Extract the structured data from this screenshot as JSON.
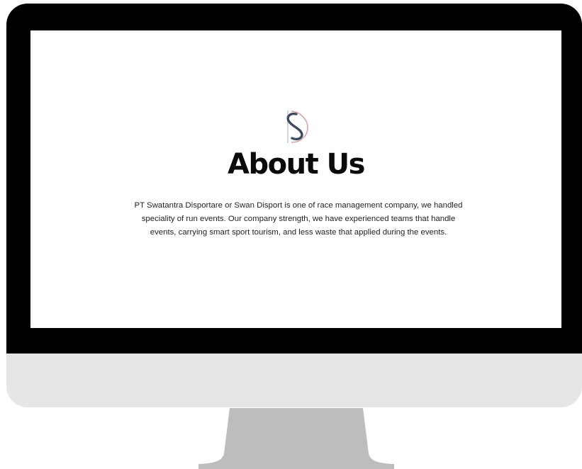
{
  "about": {
    "title": "About Us",
    "description": "PT Swatantra Disportare or Swan Disport is one of race management company, we handled speciality of run events. Our company strength, we have experienced teams that handle events, carrying smart sport tourism, and less waste that applied during the events."
  },
  "logo": {
    "icon": "swan-disport-logo-icon",
    "colors": {
      "primary": "#3e4b5c",
      "accent": "#d9aeb1"
    }
  },
  "device": {
    "type": "desktop-monitor",
    "colors": {
      "bezel": "#000000",
      "chin": "#e6e6e6",
      "stand": "#bdbdbd"
    }
  }
}
